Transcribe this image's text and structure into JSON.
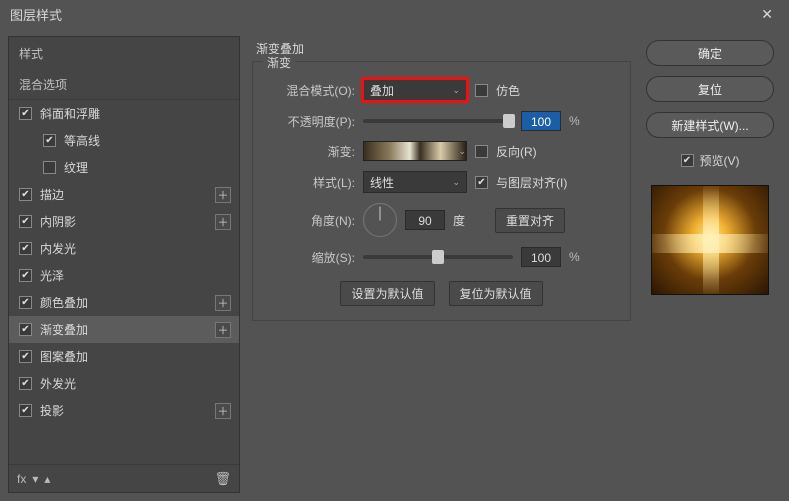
{
  "window": {
    "title": "图层样式"
  },
  "sidebar": {
    "header": "样式",
    "blending": "混合选项",
    "effects": [
      {
        "label": "斜面和浮雕",
        "checked": true,
        "add": false,
        "sub": false
      },
      {
        "label": "等高线",
        "checked": true,
        "add": false,
        "sub": true
      },
      {
        "label": "纹理",
        "checked": false,
        "add": false,
        "sub": true
      },
      {
        "label": "描边",
        "checked": true,
        "add": true,
        "sub": false
      },
      {
        "label": "内阴影",
        "checked": true,
        "add": true,
        "sub": false
      },
      {
        "label": "内发光",
        "checked": true,
        "add": false,
        "sub": false
      },
      {
        "label": "光泽",
        "checked": true,
        "add": false,
        "sub": false
      },
      {
        "label": "颜色叠加",
        "checked": true,
        "add": true,
        "sub": false
      },
      {
        "label": "渐变叠加",
        "checked": true,
        "add": true,
        "sub": false,
        "selected": true
      },
      {
        "label": "图案叠加",
        "checked": true,
        "add": false,
        "sub": false
      },
      {
        "label": "外发光",
        "checked": true,
        "add": false,
        "sub": false
      },
      {
        "label": "投影",
        "checked": true,
        "add": true,
        "sub": false
      }
    ],
    "footer": {
      "fx": "fx"
    }
  },
  "panel": {
    "group_title": "渐变叠加",
    "legend": "渐变",
    "blend_label": "混合模式(O):",
    "blend_value": "叠加",
    "dither_label": "仿色",
    "opacity_label": "不透明度(P):",
    "opacity_value": "100",
    "pct": "%",
    "gradient_label": "渐变:",
    "reverse_label": "反向(R)",
    "style_label": "样式(L):",
    "style_value": "线性",
    "align_label": "与图层对齐(I)",
    "angle_label": "角度(N):",
    "angle_value": "90",
    "deg": "度",
    "reset_align": "重置对齐",
    "scale_label": "缩放(S):",
    "scale_value": "100",
    "set_default": "设置为默认值",
    "reset_default": "复位为默认值"
  },
  "right": {
    "ok": "确定",
    "reset": "复位",
    "new_style": "新建样式(W)...",
    "preview": "预览(V)"
  }
}
